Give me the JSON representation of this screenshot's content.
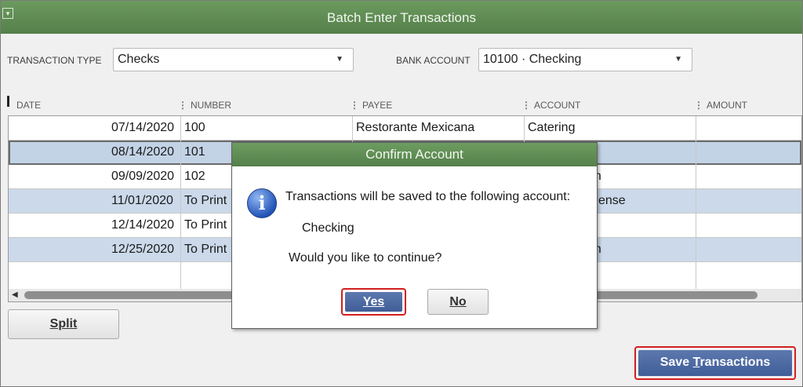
{
  "window": {
    "title": "Batch Enter Transactions",
    "menu_icon": "window-menu-icon"
  },
  "filters": {
    "transaction_type_label": "TRANSACTION TYPE",
    "transaction_type_value": "Checks",
    "bank_account_label": "BANK ACCOUNT",
    "bank_account_value": "10100 · Checking"
  },
  "grid": {
    "columns": [
      "DATE",
      "NUMBER",
      "PAYEE",
      "ACCOUNT",
      "AMOUNT"
    ],
    "rows": [
      {
        "date": "07/14/2020",
        "number": "100",
        "payee": "Restorante Mexicana",
        "account": "Catering",
        "amount": ""
      },
      {
        "date": "08/14/2020",
        "number": "101",
        "payee": "",
        "account": "",
        "amount": ""
      },
      {
        "date": "09/09/2020",
        "number": "102",
        "payee": "",
        "account": "gn",
        "amount": ""
      },
      {
        "date": "11/01/2020",
        "number": "To Print",
        "payee": "",
        "account": "ense",
        "amount": ""
      },
      {
        "date": "12/14/2020",
        "number": "To Print",
        "payee": "",
        "account": "",
        "amount": ""
      },
      {
        "date": "12/25/2020",
        "number": "To Print",
        "payee": "",
        "account": "gn",
        "amount": ""
      }
    ]
  },
  "buttons": {
    "split": "Split",
    "save_pre": "Save ",
    "save_ul": "T",
    "save_post": "ransactions"
  },
  "dialog": {
    "title": "Confirm Account",
    "message": "Transactions will be saved to the following account:",
    "account": "Checking",
    "question": "Would you like to continue?",
    "yes": "Yes",
    "no": "No",
    "icon": "info-icon"
  },
  "colors": {
    "titlebar": "#5f8c54",
    "row_alt": "#cbd9ea",
    "primary_button": "#4a67a0",
    "highlight": "#d21f1f"
  }
}
